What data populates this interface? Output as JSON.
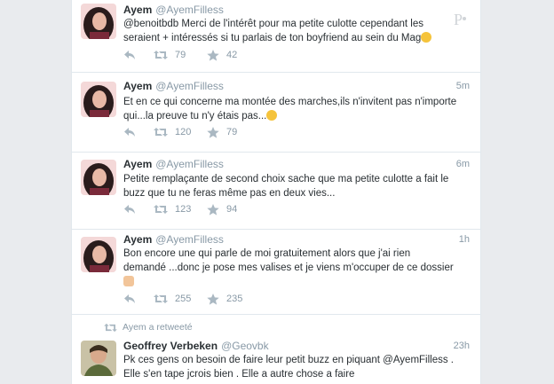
{
  "tweets": [
    {
      "name": "Ayem",
      "handle": "@AyemFilless",
      "time": "",
      "text": "@benoitbdb Merci de l'intérêt pour ma petite culotte cependant les\nseraient + intéressés si tu parlais de ton boyfriend au sein du Mag",
      "retweets": "79",
      "favorites": "42"
    },
    {
      "name": "Ayem",
      "handle": "@AyemFilless",
      "time": "5m",
      "text": "Et en ce qui concerne ma montée des marches,ils n'invitent pas n'importe\nqui...la preuve tu n'y étais pas...",
      "retweets": "120",
      "favorites": "79"
    },
    {
      "name": "Ayem",
      "handle": "@AyemFilless",
      "time": "6m",
      "text": "Petite remplaçante de second choix sache que ma petite culotte a fait le\nbuzz que tu ne feras même pas en deux vies...",
      "retweets": "123",
      "favorites": "94"
    },
    {
      "name": "Ayem",
      "handle": "@AyemFilless",
      "time": "1h",
      "text": "Bon encore une qui parle de moi gratuitement alors que j'ai rien\ndemandé ...donc je pose mes valises et je viens m'occuper de ce dossier",
      "retweets": "255",
      "favorites": "235"
    }
  ],
  "retweet_context": "Ayem a retweeté",
  "retweeted": {
    "name": "Geoffrey Verbeken",
    "handle": "@Geovbk",
    "time": "23h",
    "text": "Pk ces gens on besoin de faire leur petit buzz en piquant @AyemFilless .\nElle s'en tape jcrois bien . Elle a autre chose a faire"
  },
  "icons": [
    "reply-icon",
    "retweet-icon",
    "favorite-star-icon",
    "watermark-logo"
  ],
  "colors": {
    "icon": "#aab8c2",
    "meta": "#8899a6",
    "text": "#292f33",
    "emoji_wink": "#f5c33b"
  }
}
